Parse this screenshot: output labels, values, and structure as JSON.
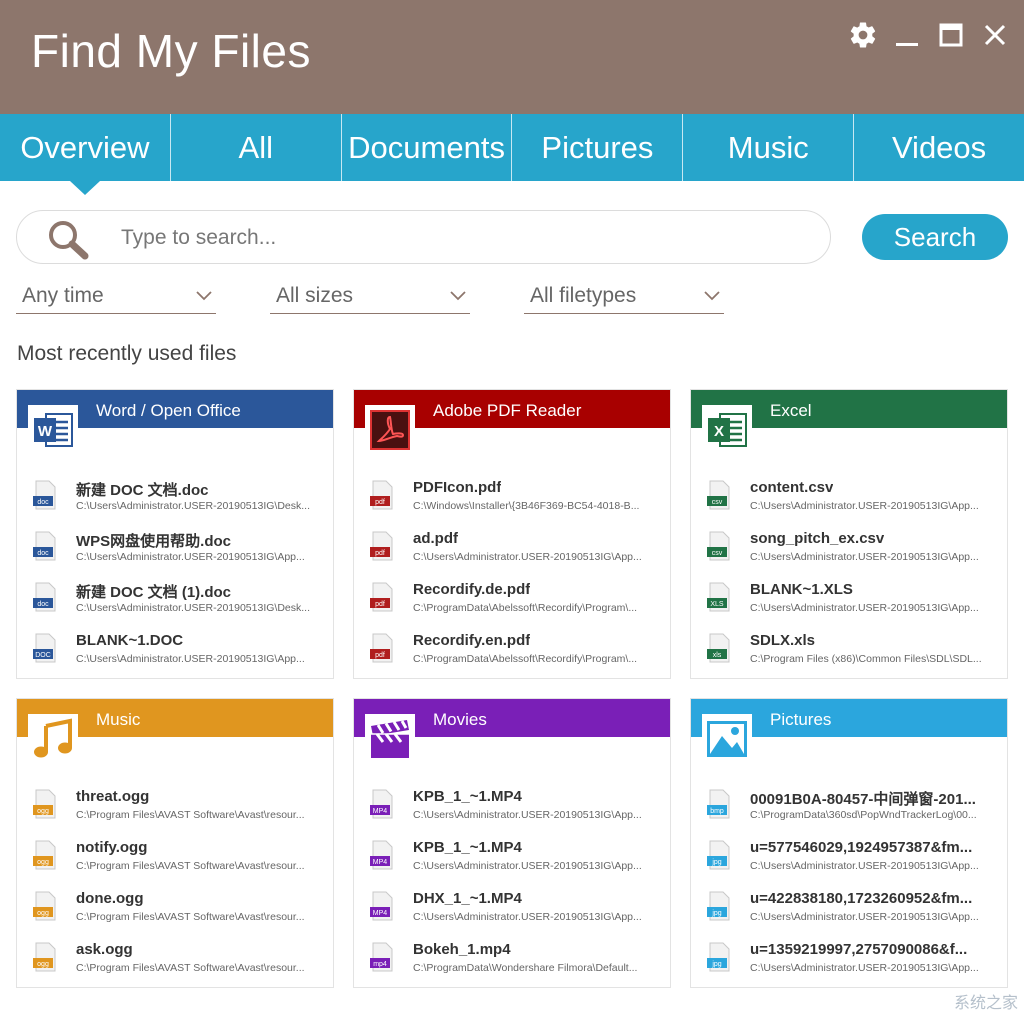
{
  "window": {
    "title": "Find My Files",
    "controls": [
      "gear-icon",
      "minimize-icon",
      "maximize-icon",
      "close-icon"
    ]
  },
  "tabs": [
    {
      "label": "Overview",
      "active": true
    },
    {
      "label": "All",
      "active": false
    },
    {
      "label": "Documents",
      "active": false
    },
    {
      "label": "Pictures",
      "active": false
    },
    {
      "label": "Music",
      "active": false
    },
    {
      "label": "Videos",
      "active": false
    }
  ],
  "search": {
    "placeholder": "Type to search...",
    "value": "",
    "button_label": "Search"
  },
  "filters": {
    "time": "Any time",
    "size": "All sizes",
    "filetype": "All filetypes"
  },
  "section_title": "Most recently used files",
  "colors": {
    "titlebar": "#8d766c",
    "accent": "#27a5cb",
    "word": "#2b579a",
    "pdf": "#a80000",
    "excel": "#217346",
    "music": "#e0961f",
    "movies": "#7a1fb7",
    "pictures": "#2ba6dd"
  },
  "cards": [
    {
      "title": "Word / Open Office",
      "icon": "word-icon",
      "files": [
        {
          "name": "新建 DOC 文档.doc",
          "path": "C:\\Users\\Administrator.USER-20190513IG\\Desk...",
          "badge": "doc"
        },
        {
          "name": "WPS网盘使用帮助.doc",
          "path": "C:\\Users\\Administrator.USER-20190513IG\\App...",
          "badge": "doc"
        },
        {
          "name": "新建 DOC 文档 (1).doc",
          "path": "C:\\Users\\Administrator.USER-20190513IG\\Desk...",
          "badge": "doc"
        },
        {
          "name": "BLANK~1.DOC",
          "path": "C:\\Users\\Administrator.USER-20190513IG\\App...",
          "badge": "DOC"
        }
      ]
    },
    {
      "title": "Adobe PDF Reader",
      "icon": "pdf-icon",
      "files": [
        {
          "name": "PDFIcon.pdf",
          "path": "C:\\Windows\\Installer\\{3B46F369-BC54-4018-B...",
          "badge": "pdf"
        },
        {
          "name": "ad.pdf",
          "path": "C:\\Users\\Administrator.USER-20190513IG\\App...",
          "badge": "pdf"
        },
        {
          "name": "Recordify.de.pdf",
          "path": "C:\\ProgramData\\Abelssoft\\Recordify\\Program\\...",
          "badge": "pdf"
        },
        {
          "name": "Recordify.en.pdf",
          "path": "C:\\ProgramData\\Abelssoft\\Recordify\\Program\\...",
          "badge": "pdf"
        }
      ]
    },
    {
      "title": "Excel",
      "icon": "excel-icon",
      "files": [
        {
          "name": "content.csv",
          "path": "C:\\Users\\Administrator.USER-20190513IG\\App...",
          "badge": "csv"
        },
        {
          "name": "song_pitch_ex.csv",
          "path": "C:\\Users\\Administrator.USER-20190513IG\\App...",
          "badge": "csv"
        },
        {
          "name": "BLANK~1.XLS",
          "path": "C:\\Users\\Administrator.USER-20190513IG\\App...",
          "badge": "XLS"
        },
        {
          "name": "SDLX.xls",
          "path": "C:\\Program Files (x86)\\Common Files\\SDL\\SDL...",
          "badge": "xls"
        }
      ]
    },
    {
      "title": "Music",
      "icon": "music-note-icon",
      "files": [
        {
          "name": "threat.ogg",
          "path": "C:\\Program Files\\AVAST Software\\Avast\\resour...",
          "badge": "ogg"
        },
        {
          "name": "notify.ogg",
          "path": "C:\\Program Files\\AVAST Software\\Avast\\resour...",
          "badge": "ogg"
        },
        {
          "name": "done.ogg",
          "path": "C:\\Program Files\\AVAST Software\\Avast\\resour...",
          "badge": "ogg"
        },
        {
          "name": "ask.ogg",
          "path": "C:\\Program Files\\AVAST Software\\Avast\\resour...",
          "badge": "ogg"
        }
      ]
    },
    {
      "title": "Movies",
      "icon": "clapperboard-icon",
      "files": [
        {
          "name": "KPB_1_~1.MP4",
          "path": "C:\\Users\\Administrator.USER-20190513IG\\App...",
          "badge": "MP4"
        },
        {
          "name": "KPB_1_~1.MP4",
          "path": "C:\\Users\\Administrator.USER-20190513IG\\App...",
          "badge": "MP4"
        },
        {
          "name": "DHX_1_~1.MP4",
          "path": "C:\\Users\\Administrator.USER-20190513IG\\App...",
          "badge": "MP4"
        },
        {
          "name": "Bokeh_1.mp4",
          "path": "C:\\ProgramData\\Wondershare Filmora\\Default...",
          "badge": "mp4"
        }
      ]
    },
    {
      "title": "Pictures",
      "icon": "picture-icon",
      "files": [
        {
          "name": "00091B0A-80457-中间弹窗-201...",
          "path": "C:\\ProgramData\\360sd\\PopWndTrackerLog\\00...",
          "badge": "bmp"
        },
        {
          "name": "u=577546029,1924957387&fm...",
          "path": "C:\\Users\\Administrator.USER-20190513IG\\App...",
          "badge": "jpg"
        },
        {
          "name": "u=422838180,1723260952&fm...",
          "path": "C:\\Users\\Administrator.USER-20190513IG\\App...",
          "badge": "jpg"
        },
        {
          "name": "u=1359219997,2757090086&f...",
          "path": "C:\\Users\\Administrator.USER-20190513IG\\App...",
          "badge": "jpg"
        }
      ]
    }
  ],
  "watermark": "系统之家"
}
